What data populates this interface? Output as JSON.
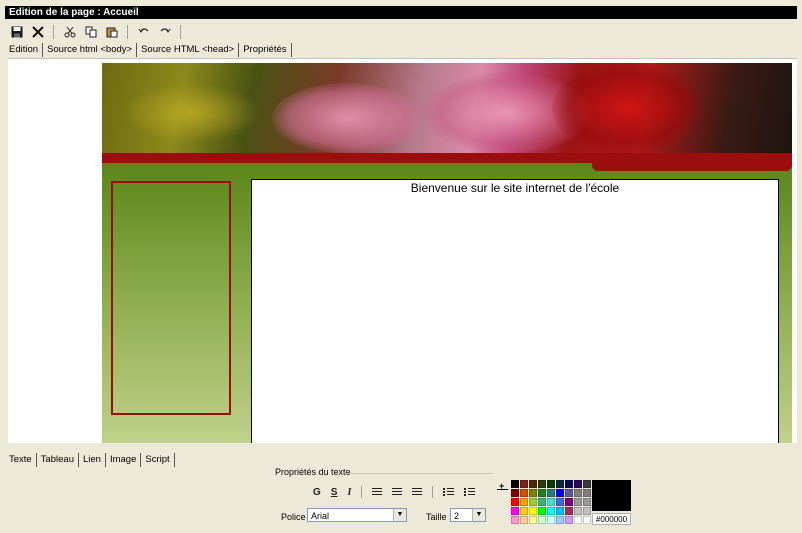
{
  "window": {
    "title": "Edition de la page : Accueil"
  },
  "toolbar": {
    "icons": [
      "save-icon",
      "close-icon",
      "cut-icon",
      "copy-icon",
      "paste-icon",
      "undo-icon",
      "redo-icon"
    ]
  },
  "top_tabs": [
    {
      "label": "Edition"
    },
    {
      "label": "Source html <body>"
    },
    {
      "label": "Source HTML <head>"
    },
    {
      "label": "Propriétés"
    }
  ],
  "editor": {
    "welcome_text": "Bienvenue sur le site internet de l'école",
    "colors": {
      "banner_red": "#9c0e0e",
      "green_dark": "#3d6a10",
      "green_light": "#c0d08a"
    }
  },
  "bottom_tabs": [
    {
      "label": "Texte"
    },
    {
      "label": "Tableau"
    },
    {
      "label": "Lien"
    },
    {
      "label": "Image"
    },
    {
      "label": "Script"
    }
  ],
  "text_properties": {
    "title": "Propriétés du texte",
    "bold": "G",
    "underline": "S",
    "italic": "I",
    "plus": "+",
    "police_label": "Police :",
    "police_value": "Arial",
    "taille_label": "Taille :",
    "taille_value": "2",
    "current_color_hex": "#000000"
  },
  "palette": [
    "#000000",
    "#7f1f1f",
    "#4a2a0a",
    "#2a3a0a",
    "#0a3a0a",
    "#0a2a3a",
    "#0a0a5a",
    "#2a0a5a",
    "#3a3a3a",
    "#7f0000",
    "#d05000",
    "#7f7f00",
    "#207f20",
    "#207f7f",
    "#0000ff",
    "#5a5a9a",
    "#7f7f7f",
    "#7f7f7f",
    "#ff0000",
    "#ff9900",
    "#9acd32",
    "#3cb371",
    "#40e0d0",
    "#4169e1",
    "#800080",
    "#999999",
    "#999999",
    "#ff00ff",
    "#ffcc00",
    "#ffff00",
    "#00ff00",
    "#00ffff",
    "#00bfff",
    "#993366",
    "#c0c0c0",
    "#c0c0c0",
    "#ff99cc",
    "#ffcc99",
    "#ffff99",
    "#ccffcc",
    "#ccffff",
    "#99ccff",
    "#cc99ff",
    "#ffffff",
    "#ffffff"
  ]
}
